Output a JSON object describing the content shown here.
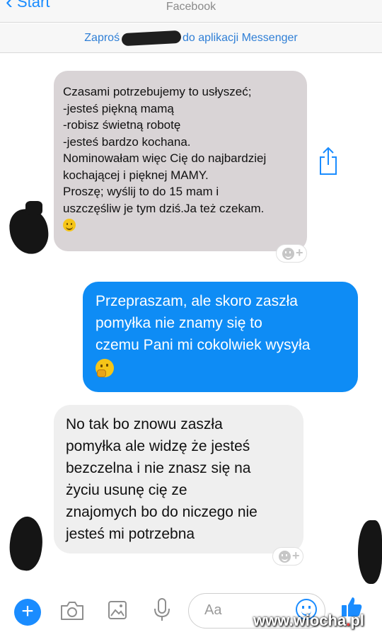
{
  "header": {
    "back_label": "Start",
    "title": "Facebook"
  },
  "invite_banner": {
    "before": "Zaproś",
    "after": "do aplikacji Messenger"
  },
  "messages": [
    {
      "side": "incoming",
      "lines": [
        "Czasami potrzebujemy to usłyszeć;",
        "-jesteś piękną mamą",
        "-robisz świetną robotę",
        "-jesteś bardzo kochana.",
        "Nominowałam więc Cię do najbardziej",
        "kochającej i pięknej MAMY.",
        "Proszę; wyślij to do 15 mam i",
        "uszczęśliw je tym dziś.Ja też czekam."
      ],
      "emoji": "slightly-smiling-face"
    },
    {
      "side": "outgoing",
      "lines": [
        "Przepraszam, ale skoro zaszła",
        "pomyłka nie znamy się to",
        "czemu Pani mi cokolwiek wysyła"
      ],
      "emoji": "thinking-face"
    },
    {
      "side": "incoming",
      "lines": [
        "No tak bo znowu zaszła",
        "pomyłka ale widzę że jesteś",
        "bezczelna i nie znasz się na",
        "życiu usunę cię ze",
        "znajomych bo do niczego nie",
        "jesteś mi potrzebna"
      ]
    }
  ],
  "composer": {
    "placeholder": "Aa"
  },
  "watermark": {
    "prefix": "www.wiocha",
    "dot": ".",
    "suffix": "pl"
  },
  "colors": {
    "accent": "#1a8cff",
    "outgoing_bubble": "#0e8cf5",
    "forwarded_bubble": "#d9d4d6",
    "incoming_bubble": "#efefef"
  }
}
